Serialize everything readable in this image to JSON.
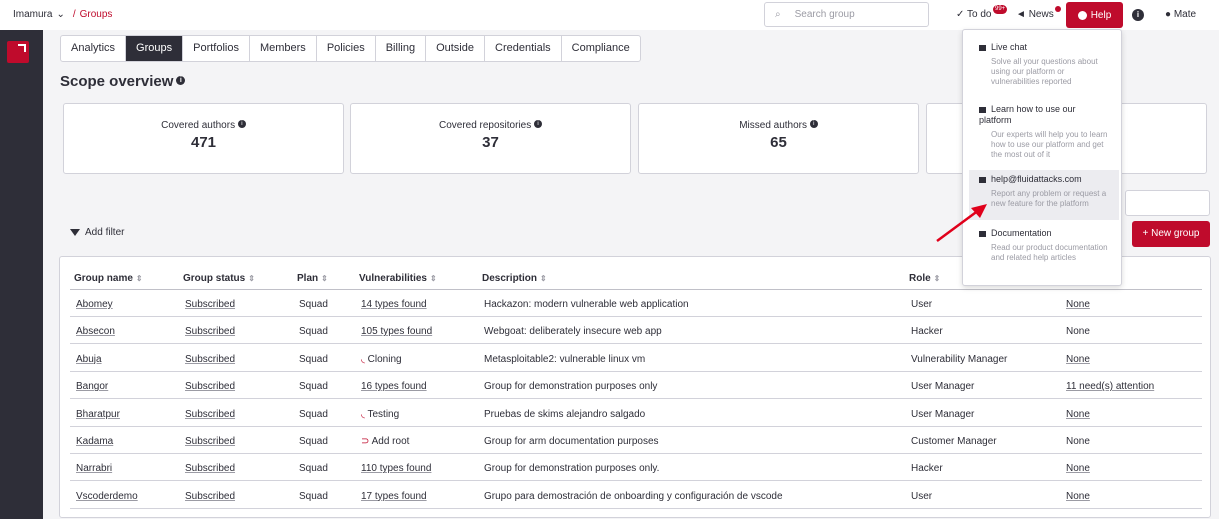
{
  "breadcrumb": {
    "org": "Imamura",
    "separator": "/",
    "current": "Groups"
  },
  "search": {
    "placeholder": "Search group"
  },
  "topbar": {
    "todo": "To do",
    "todo_badge": "99+",
    "news": "News",
    "help": "Help",
    "user": "Mate"
  },
  "tabs": [
    "Analytics",
    "Groups",
    "Portfolios",
    "Members",
    "Policies",
    "Billing",
    "Outside",
    "Credentials",
    "Compliance"
  ],
  "active_tab": "Groups",
  "scope": {
    "title": "Scope overview",
    "cards": [
      {
        "label": "Covered authors",
        "value": "471"
      },
      {
        "label": "Covered repositories",
        "value": "37"
      },
      {
        "label": "Missed authors",
        "value": "65"
      }
    ]
  },
  "actions": {
    "add_filter": "Add filter",
    "new_group": "+ New group"
  },
  "table": {
    "headers": [
      "Group name",
      "Group status",
      "Plan",
      "Vulnerabilities",
      "Description",
      "Role"
    ],
    "rows": [
      {
        "name": "Abomey",
        "status": "Subscribed",
        "plan": "Squad",
        "vulns": "14 types found",
        "desc": "Hackazon: modern vulnerable web application",
        "role": "User",
        "events": "None"
      },
      {
        "name": "Absecon",
        "status": "Subscribed",
        "plan": "Squad",
        "vulns": "105 types found",
        "desc": "Webgoat: deliberately insecure web app",
        "role": "Hacker",
        "events": "None"
      },
      {
        "name": "Abuja",
        "status": "Subscribed",
        "plan": "Squad",
        "vulns": "Cloning",
        "desc": "Metasploitable2: vulnerable linux vm",
        "role": "Vulnerability Manager",
        "events": "None"
      },
      {
        "name": "Bangor",
        "status": "Subscribed",
        "plan": "Squad",
        "vulns": "16 types found",
        "desc": "Group for demonstration purposes only",
        "role": "User Manager",
        "events": "11 need(s) attention"
      },
      {
        "name": "Bharatpur",
        "status": "Subscribed",
        "plan": "Squad",
        "vulns": "Testing",
        "desc": "Pruebas de skims alejandro salgado",
        "role": "User Manager",
        "events": "None"
      },
      {
        "name": "Kadama",
        "status": "Subscribed",
        "plan": "Squad",
        "vulns": "Add root",
        "desc": "Group for arm documentation purposes",
        "role": "Customer Manager",
        "events": "None"
      },
      {
        "name": "Narrabri",
        "status": "Subscribed",
        "plan": "Squad",
        "vulns": "110 types found",
        "desc": "Group for demonstration purposes only.",
        "role": "Hacker",
        "events": "None"
      },
      {
        "name": "Vscoderdemo",
        "status": "Subscribed",
        "plan": "Squad",
        "vulns": "17 types found",
        "desc": "Grupo para demostración de onboarding y configuración de vscode",
        "role": "User",
        "events": "None"
      }
    ]
  },
  "help_menu": [
    {
      "title": "Live chat",
      "desc": "Solve all your questions about using our platform or vulnerabilities reported"
    },
    {
      "title": "Learn how to use our platform",
      "desc": "Our experts will help you to learn how to use our platform and get the most out of it"
    },
    {
      "title": "help@fluidattacks.com",
      "desc": "Report any problem or request a new feature for the platform"
    },
    {
      "title": "Documentation",
      "desc": "Read our product documentation and related help articles"
    }
  ],
  "colors": {
    "brand": "#bf0b2c",
    "dark": "#2e2e38",
    "arrow": "#e0001b"
  }
}
